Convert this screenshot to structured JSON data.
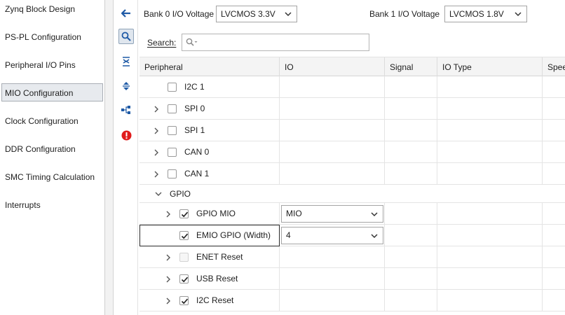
{
  "nav": {
    "items": [
      {
        "label": "Zynq Block Design"
      },
      {
        "label": "PS-PL Configuration"
      },
      {
        "label": "Peripheral I/O Pins"
      },
      {
        "label": "MIO Configuration"
      },
      {
        "label": "Clock Configuration"
      },
      {
        "label": "DDR Configuration"
      },
      {
        "label": "SMC Timing Calculation"
      },
      {
        "label": "Interrupts"
      }
    ],
    "active": "MIO Configuration"
  },
  "toolbar": {
    "icons": [
      "back-arrow-icon",
      "search-icon",
      "collapse-all-icon",
      "expand-all-icon",
      "hierarchy-icon",
      "error-icon"
    ],
    "accent": "#1f5aa6",
    "error_color": "#e01b1b"
  },
  "bank0": {
    "label": "Bank 0 I/O Voltage",
    "value": "LVCMOS 3.3V"
  },
  "bank1": {
    "label": "Bank 1 I/O Voltage",
    "value": "LVCMOS 1.8V"
  },
  "search": {
    "label": "Search:",
    "value": ""
  },
  "table": {
    "columns": [
      "Peripheral",
      "IO",
      "Signal",
      "IO Type",
      "Spee"
    ],
    "rows": {
      "i2c1": {
        "label": "I2C 1",
        "checked": false
      },
      "spi0": {
        "label": "SPI 0",
        "checked": false
      },
      "spi1": {
        "label": "SPI 1",
        "checked": false
      },
      "can0": {
        "label": "CAN 0",
        "checked": false
      },
      "can1": {
        "label": "CAN 1",
        "checked": false
      },
      "gpio": {
        "label": "GPIO"
      },
      "gpio_mio": {
        "label": "GPIO MIO",
        "checked": true,
        "io": "MIO"
      },
      "emio_gpio": {
        "label": "EMIO GPIO (Width)",
        "checked": true,
        "io": "4"
      },
      "enet_reset": {
        "label": "ENET Reset",
        "checked": false,
        "disabled": true
      },
      "usb_reset": {
        "label": "USB Reset",
        "checked": true
      },
      "i2c_reset": {
        "label": "I2C Reset",
        "checked": true
      }
    }
  }
}
